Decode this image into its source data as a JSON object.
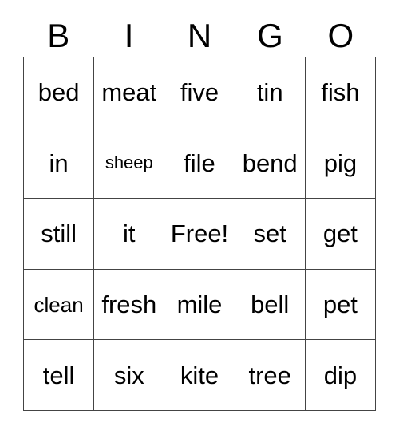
{
  "card": {
    "header_letters": [
      "B",
      "I",
      "N",
      "G",
      "O"
    ],
    "free_space_label": "Free!",
    "colors": {
      "background": "#ffffff",
      "text": "#000000",
      "grid_line": "#444444",
      "cell_background": "#ffffff"
    },
    "grid": {
      "rows": 5,
      "columns": 5,
      "cells": [
        [
          {
            "text": "bed",
            "size": "normal",
            "free": false
          },
          {
            "text": "meat",
            "size": "normal",
            "free": false
          },
          {
            "text": "five",
            "size": "normal",
            "free": false
          },
          {
            "text": "tin",
            "size": "normal",
            "free": false
          },
          {
            "text": "fish",
            "size": "normal",
            "free": false
          }
        ],
        [
          {
            "text": "in",
            "size": "normal",
            "free": false
          },
          {
            "text": "sheep",
            "size": "small",
            "free": false
          },
          {
            "text": "file",
            "size": "normal",
            "free": false
          },
          {
            "text": "bend",
            "size": "normal",
            "free": false
          },
          {
            "text": "pig",
            "size": "normal",
            "free": false
          }
        ],
        [
          {
            "text": "still",
            "size": "normal",
            "free": false
          },
          {
            "text": "it",
            "size": "normal",
            "free": false
          },
          {
            "text": "Free!",
            "size": "normal",
            "free": true
          },
          {
            "text": "set",
            "size": "normal",
            "free": false
          },
          {
            "text": "get",
            "size": "normal",
            "free": false
          }
        ],
        [
          {
            "text": "clean",
            "size": "medium",
            "free": false
          },
          {
            "text": "fresh",
            "size": "normal",
            "free": false
          },
          {
            "text": "mile",
            "size": "normal",
            "free": false
          },
          {
            "text": "bell",
            "size": "normal",
            "free": false
          },
          {
            "text": "pet",
            "size": "normal",
            "free": false
          }
        ],
        [
          {
            "text": "tell",
            "size": "normal",
            "free": false
          },
          {
            "text": "six",
            "size": "normal",
            "free": false
          },
          {
            "text": "kite",
            "size": "normal",
            "free": false
          },
          {
            "text": "tree",
            "size": "normal",
            "free": false
          },
          {
            "text": "dip",
            "size": "normal",
            "free": false
          }
        ]
      ]
    }
  }
}
